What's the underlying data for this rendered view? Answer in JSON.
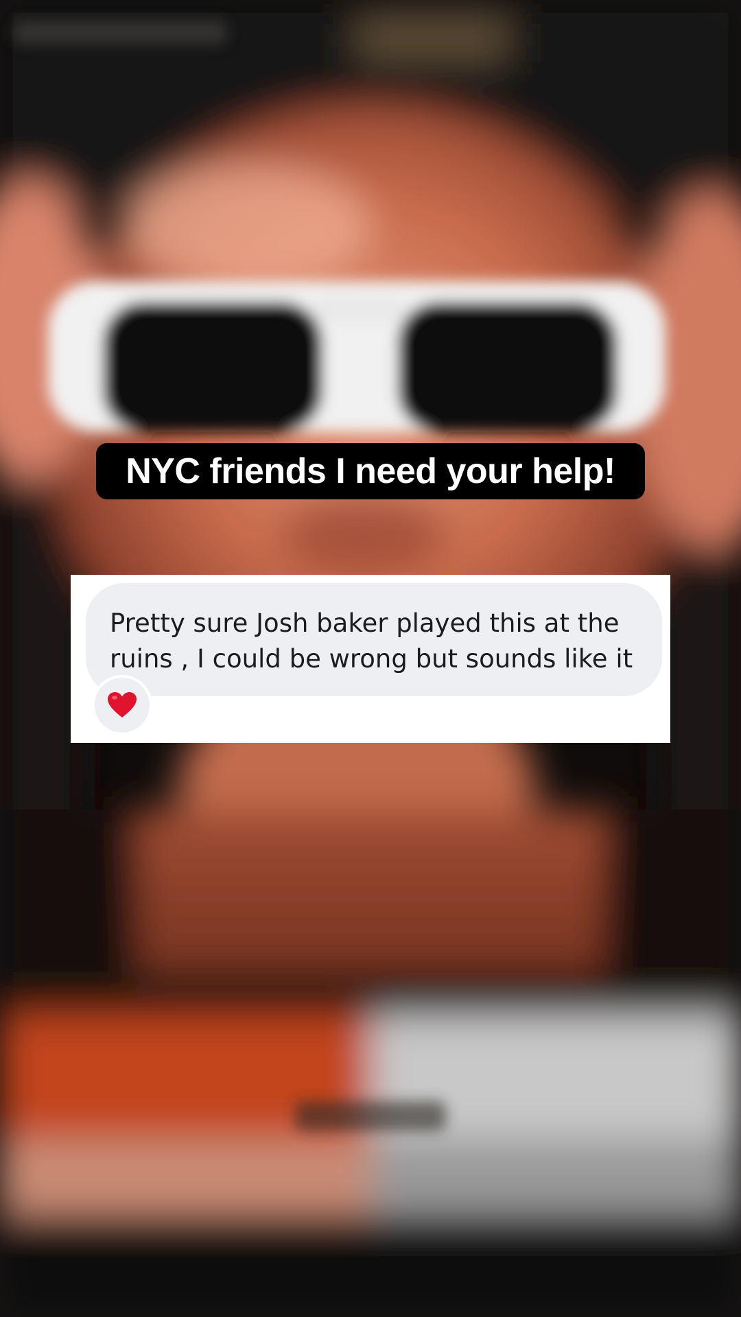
{
  "caption": {
    "text": "NYC friends I need your help!"
  },
  "comment": {
    "text": "Pretty sure Josh baker played this at the\nruins , I could be wrong but sounds like it",
    "reaction_icon": "red-heart-icon",
    "reaction_color": "#e0142e",
    "bubble_color": "#eeeff2"
  },
  "video": {
    "background": "blurred-portrait-with-white-sunglasses"
  }
}
